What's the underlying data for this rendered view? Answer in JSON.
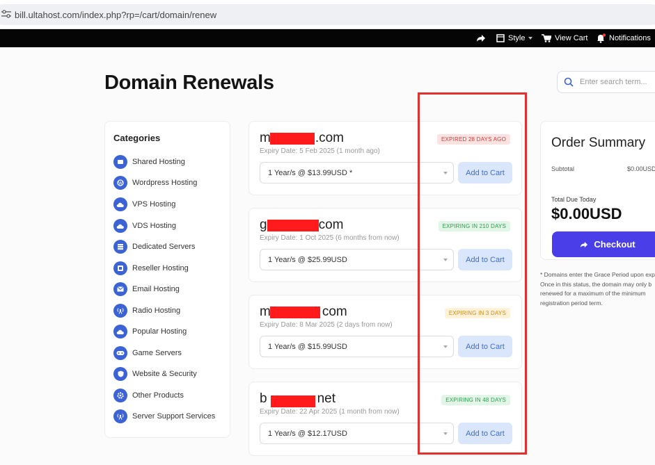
{
  "browser": {
    "url": "bill.ultahost.com/index.php?rp=/cart/domain/renew"
  },
  "topnav": {
    "style_label": "Style",
    "cart_label": "View Cart",
    "notifications_label": "Notifications"
  },
  "page": {
    "title": "Domain Renewals"
  },
  "search": {
    "placeholder": "Enter search term..."
  },
  "categories": {
    "title": "Categories",
    "items": [
      {
        "label": "Shared Hosting",
        "icon": "cloud-server-icon"
      },
      {
        "label": "Wordpress Hosting",
        "icon": "wordpress-icon"
      },
      {
        "label": "VPS Hosting",
        "icon": "cloud-icon"
      },
      {
        "label": "VDS Hosting",
        "icon": "cloud-icon"
      },
      {
        "label": "Dedicated Servers",
        "icon": "server-icon"
      },
      {
        "label": "Reseller Hosting",
        "icon": "reseller-icon"
      },
      {
        "label": "Email Hosting",
        "icon": "envelope-icon"
      },
      {
        "label": "Radio Hosting",
        "icon": "radio-tower-icon"
      },
      {
        "label": "Popular Hosting",
        "icon": "cloud-icon"
      },
      {
        "label": "Game Servers",
        "icon": "gamepad-icon"
      },
      {
        "label": "Website & Security",
        "icon": "shield-icon"
      },
      {
        "label": "Other Products",
        "icon": "gear-icon"
      },
      {
        "label": "Server Support Services",
        "icon": "support-icon"
      }
    ]
  },
  "domains": [
    {
      "name_prefix": "m",
      "name_suffix": ".com",
      "expiry": "Expiry Date: 5 Feb 2025 (1 month ago)",
      "status": "EXPIRED 28 DAYS AGO",
      "status_kind": "expired",
      "option": "1 Year/s @ $13.99USD *",
      "button": "Add to Cart"
    },
    {
      "name_prefix": "g",
      "name_suffix": "com",
      "expiry": "Expiry Date: 1 Oct 2025 (6 months from now)",
      "status": "EXPIRING IN 210 DAYS",
      "status_kind": "expiring",
      "option": "1 Year/s @ $25.99USD",
      "button": "Add to Cart"
    },
    {
      "name_prefix": "m",
      "name_suffix": "com",
      "expiry": "Expiry Date: 8 Mar 2025 (2 days from now)",
      "status": "EXPIRING IN 3 DAYS",
      "status_kind": "soon",
      "option": "1 Year/s @ $15.99USD",
      "button": "Add to Cart"
    },
    {
      "name_prefix": "b",
      "name_suffix": "net",
      "expiry": "Expiry Date: 22 Apr 2025 (1 month from now)",
      "status": "EXPIRING IN 48 DAYS",
      "status_kind": "expiring",
      "option": "1 Year/s @ $12.17USD",
      "button": "Add to Cart"
    }
  ],
  "summary": {
    "title": "Order Summary",
    "subtotal_label": "Subtotal",
    "subtotal_value": "$0.00USD",
    "total_label": "Total Due Today",
    "total_value": "$0.00USD",
    "checkout_label": "Checkout"
  },
  "note_lines": [
    "* Domains enter the Grace Period upon exp",
    "Once in this status, the domain may only b",
    "renewed for a maximum of the minimum",
    "registration period term."
  ],
  "colors": {
    "accent": "#3b63d6",
    "checkout": "#4a3ee8",
    "highlight": "#e03030",
    "redaction": "#ff1b1b"
  }
}
